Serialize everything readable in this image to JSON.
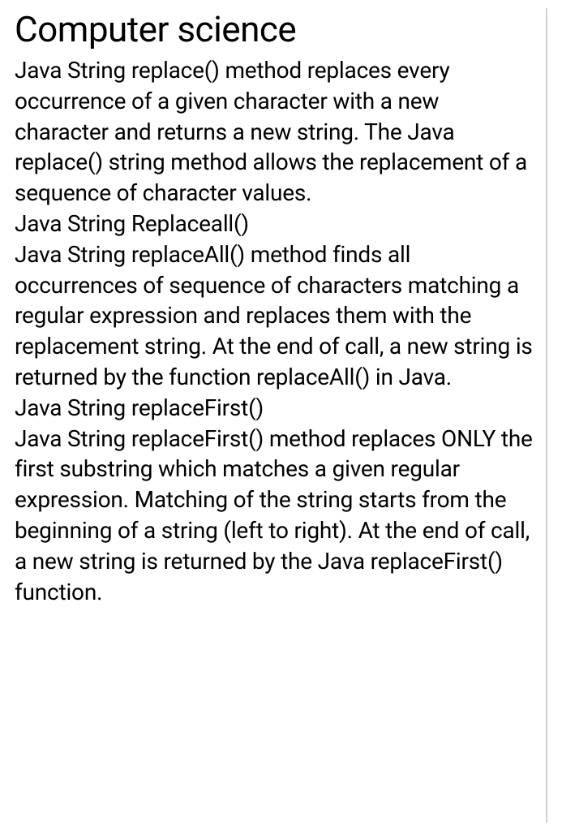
{
  "document": {
    "title": "Computer science",
    "body": "Java String replace() method replaces every occurrence of a given character with a new character and returns a new string. The Java replace() string method allows the replacement of a sequence of character values.\nJava String Replaceall()\nJava String replaceAll() method finds all occurrences of sequence of characters matching a regular expression and replaces them with the replacement string. At the end of call, a new string is returned by the function replaceAll() in Java.\nJava String replaceFirst()\nJava String replaceFirst() method replaces ONLY the first substring which matches a given regular expression. Matching of the string starts from the beginning of a string (left to right). At the end of call, a new string is returned by the Java replaceFirst() function."
  }
}
